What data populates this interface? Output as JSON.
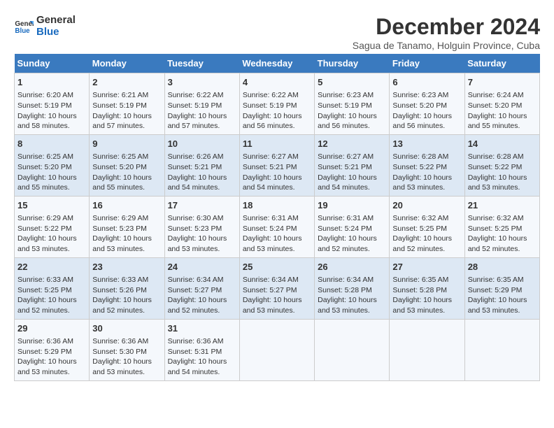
{
  "logo": {
    "text_general": "General",
    "text_blue": "Blue"
  },
  "title": "December 2024",
  "subtitle": "Sagua de Tanamo, Holguin Province, Cuba",
  "days_of_week": [
    "Sunday",
    "Monday",
    "Tuesday",
    "Wednesday",
    "Thursday",
    "Friday",
    "Saturday"
  ],
  "weeks": [
    [
      {
        "day": "1",
        "info": "Sunrise: 6:20 AM\nSunset: 5:19 PM\nDaylight: 10 hours\nand 58 minutes."
      },
      {
        "day": "2",
        "info": "Sunrise: 6:21 AM\nSunset: 5:19 PM\nDaylight: 10 hours\nand 57 minutes."
      },
      {
        "day": "3",
        "info": "Sunrise: 6:22 AM\nSunset: 5:19 PM\nDaylight: 10 hours\nand 57 minutes."
      },
      {
        "day": "4",
        "info": "Sunrise: 6:22 AM\nSunset: 5:19 PM\nDaylight: 10 hours\nand 56 minutes."
      },
      {
        "day": "5",
        "info": "Sunrise: 6:23 AM\nSunset: 5:19 PM\nDaylight: 10 hours\nand 56 minutes."
      },
      {
        "day": "6",
        "info": "Sunrise: 6:23 AM\nSunset: 5:20 PM\nDaylight: 10 hours\nand 56 minutes."
      },
      {
        "day": "7",
        "info": "Sunrise: 6:24 AM\nSunset: 5:20 PM\nDaylight: 10 hours\nand 55 minutes."
      }
    ],
    [
      {
        "day": "8",
        "info": "Sunrise: 6:25 AM\nSunset: 5:20 PM\nDaylight: 10 hours\nand 55 minutes."
      },
      {
        "day": "9",
        "info": "Sunrise: 6:25 AM\nSunset: 5:20 PM\nDaylight: 10 hours\nand 55 minutes."
      },
      {
        "day": "10",
        "info": "Sunrise: 6:26 AM\nSunset: 5:21 PM\nDaylight: 10 hours\nand 54 minutes."
      },
      {
        "day": "11",
        "info": "Sunrise: 6:27 AM\nSunset: 5:21 PM\nDaylight: 10 hours\nand 54 minutes."
      },
      {
        "day": "12",
        "info": "Sunrise: 6:27 AM\nSunset: 5:21 PM\nDaylight: 10 hours\nand 54 minutes."
      },
      {
        "day": "13",
        "info": "Sunrise: 6:28 AM\nSunset: 5:22 PM\nDaylight: 10 hours\nand 53 minutes."
      },
      {
        "day": "14",
        "info": "Sunrise: 6:28 AM\nSunset: 5:22 PM\nDaylight: 10 hours\nand 53 minutes."
      }
    ],
    [
      {
        "day": "15",
        "info": "Sunrise: 6:29 AM\nSunset: 5:22 PM\nDaylight: 10 hours\nand 53 minutes."
      },
      {
        "day": "16",
        "info": "Sunrise: 6:29 AM\nSunset: 5:23 PM\nDaylight: 10 hours\nand 53 minutes."
      },
      {
        "day": "17",
        "info": "Sunrise: 6:30 AM\nSunset: 5:23 PM\nDaylight: 10 hours\nand 53 minutes."
      },
      {
        "day": "18",
        "info": "Sunrise: 6:31 AM\nSunset: 5:24 PM\nDaylight: 10 hours\nand 53 minutes."
      },
      {
        "day": "19",
        "info": "Sunrise: 6:31 AM\nSunset: 5:24 PM\nDaylight: 10 hours\nand 52 minutes."
      },
      {
        "day": "20",
        "info": "Sunrise: 6:32 AM\nSunset: 5:25 PM\nDaylight: 10 hours\nand 52 minutes."
      },
      {
        "day": "21",
        "info": "Sunrise: 6:32 AM\nSunset: 5:25 PM\nDaylight: 10 hours\nand 52 minutes."
      }
    ],
    [
      {
        "day": "22",
        "info": "Sunrise: 6:33 AM\nSunset: 5:25 PM\nDaylight: 10 hours\nand 52 minutes."
      },
      {
        "day": "23",
        "info": "Sunrise: 6:33 AM\nSunset: 5:26 PM\nDaylight: 10 hours\nand 52 minutes."
      },
      {
        "day": "24",
        "info": "Sunrise: 6:34 AM\nSunset: 5:27 PM\nDaylight: 10 hours\nand 52 minutes."
      },
      {
        "day": "25",
        "info": "Sunrise: 6:34 AM\nSunset: 5:27 PM\nDaylight: 10 hours\nand 53 minutes."
      },
      {
        "day": "26",
        "info": "Sunrise: 6:34 AM\nSunset: 5:28 PM\nDaylight: 10 hours\nand 53 minutes."
      },
      {
        "day": "27",
        "info": "Sunrise: 6:35 AM\nSunset: 5:28 PM\nDaylight: 10 hours\nand 53 minutes."
      },
      {
        "day": "28",
        "info": "Sunrise: 6:35 AM\nSunset: 5:29 PM\nDaylight: 10 hours\nand 53 minutes."
      }
    ],
    [
      {
        "day": "29",
        "info": "Sunrise: 6:36 AM\nSunset: 5:29 PM\nDaylight: 10 hours\nand 53 minutes."
      },
      {
        "day": "30",
        "info": "Sunrise: 6:36 AM\nSunset: 5:30 PM\nDaylight: 10 hours\nand 53 minutes."
      },
      {
        "day": "31",
        "info": "Sunrise: 6:36 AM\nSunset: 5:31 PM\nDaylight: 10 hours\nand 54 minutes."
      },
      {
        "day": "",
        "info": ""
      },
      {
        "day": "",
        "info": ""
      },
      {
        "day": "",
        "info": ""
      },
      {
        "day": "",
        "info": ""
      }
    ]
  ]
}
